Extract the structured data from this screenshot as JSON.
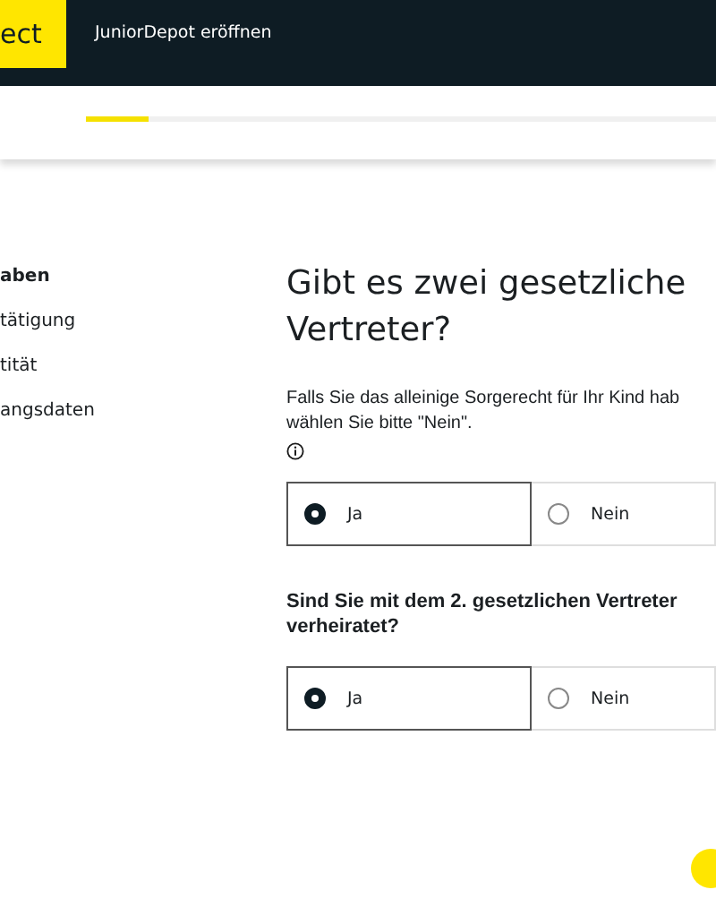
{
  "header": {
    "logo": "ect",
    "title": "JuniorDepot eröffnen"
  },
  "progress": {
    "level": 0.1
  },
  "sidebar": {
    "items": [
      {
        "label": "aben",
        "selected": true
      },
      {
        "label": "tätigung",
        "selected": false
      },
      {
        "label": "tität",
        "selected": false
      },
      {
        "label": "angsdaten",
        "selected": false
      }
    ]
  },
  "main": {
    "heading": "Gibt es zwei gesetzliche Vertreter?",
    "hint_lines": [
      "Falls Sie das alleinige Sorgerecht für Ihr Kind hab",
      "wählen Sie bitte \"Nein\"."
    ],
    "questions": [
      {
        "options": [
          {
            "label": "Ja",
            "selected": true
          },
          {
            "label": "Nein",
            "selected": false
          }
        ]
      },
      {
        "label": "Sind Sie mit dem 2. gesetzlichen Vertreter verheiratet?",
        "options": [
          {
            "label": "Ja",
            "selected": true
          },
          {
            "label": "Nein",
            "selected": false
          }
        ]
      }
    ]
  }
}
